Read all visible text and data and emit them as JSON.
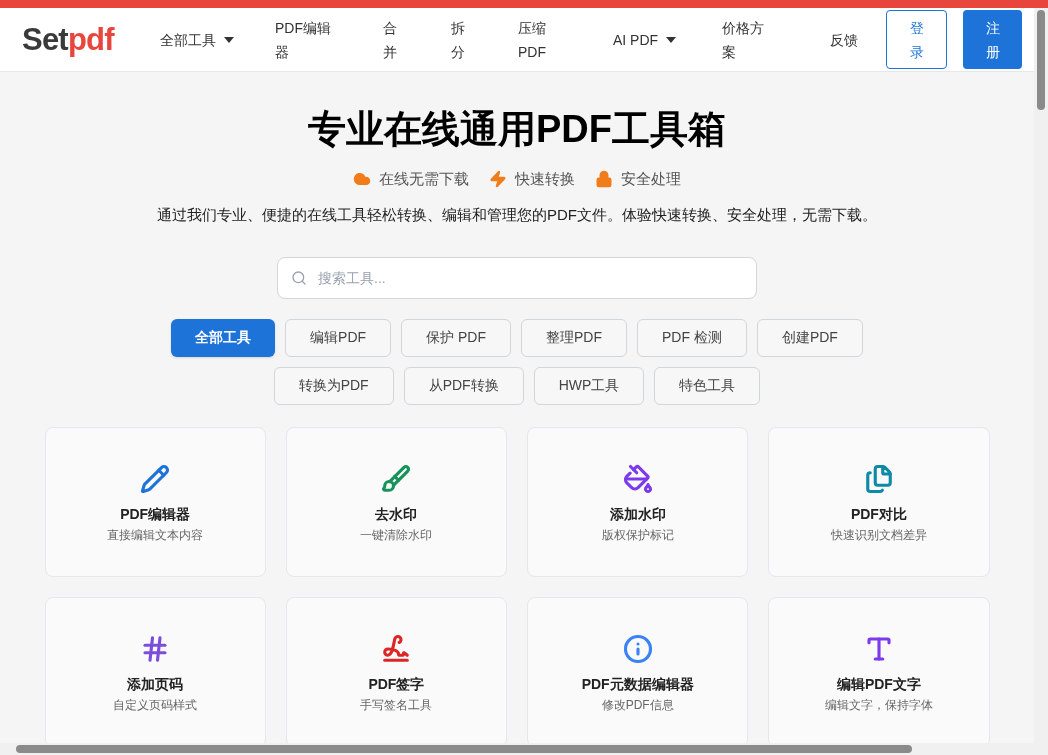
{
  "header": {
    "logo": {
      "part1": "Set",
      "part2": "pdf"
    },
    "nav": [
      {
        "label": "全部工具",
        "dropdown": true
      },
      {
        "label": "PDF编辑器",
        "dropdown": false
      },
      {
        "label": "合并",
        "dropdown": false
      },
      {
        "label": "拆分",
        "dropdown": false
      },
      {
        "label": "压缩PDF",
        "dropdown": false
      },
      {
        "label": "AI PDF",
        "dropdown": true
      },
      {
        "label": "价格方案",
        "dropdown": false
      },
      {
        "label": "反馈",
        "dropdown": false
      }
    ],
    "buttons": [
      {
        "label": "登录",
        "kind": "outline"
      },
      {
        "label": "注册",
        "kind": "primary"
      }
    ]
  },
  "hero": {
    "title": "专业在线通用PDF工具箱",
    "features": [
      {
        "label": "在线无需下载"
      },
      {
        "label": "快速转换"
      },
      {
        "label": "安全处理"
      }
    ],
    "description": "通过我们专业、便捷的在线工具轻松转换、编辑和管理您的PDF文件。体验快速转换、安全处理，无需下载。"
  },
  "search": {
    "placeholder": "搜索工具..."
  },
  "categories": [
    {
      "label": "全部工具",
      "selected": true
    },
    {
      "label": "编辑PDF",
      "selected": false
    },
    {
      "label": "保护 PDF",
      "selected": false
    },
    {
      "label": "整理PDF",
      "selected": false
    },
    {
      "label": "PDF 检测",
      "selected": false
    },
    {
      "label": "创建PDF",
      "selected": false
    },
    {
      "label": "转换为PDF",
      "selected": false
    },
    {
      "label": "从PDF转换",
      "selected": false
    },
    {
      "label": "HWP工具",
      "selected": false
    },
    {
      "label": "特色工具",
      "selected": false
    }
  ],
  "tools": [
    {
      "title": "PDF编辑器",
      "subtitle": "直接编辑文本内容"
    },
    {
      "title": "去水印",
      "subtitle": "一键清除水印"
    },
    {
      "title": "添加水印",
      "subtitle": "版权保护标记"
    },
    {
      "title": "PDF对比",
      "subtitle": "快速识别文档差异"
    },
    {
      "title": "添加页码",
      "subtitle": "自定义页码样式"
    },
    {
      "title": "PDF签字",
      "subtitle": "手写签名工具"
    },
    {
      "title": "PDF元数据编辑器",
      "subtitle": "修改PDF信息"
    },
    {
      "title": "编辑PDF文字",
      "subtitle": "编辑文字，保持字体"
    }
  ]
}
